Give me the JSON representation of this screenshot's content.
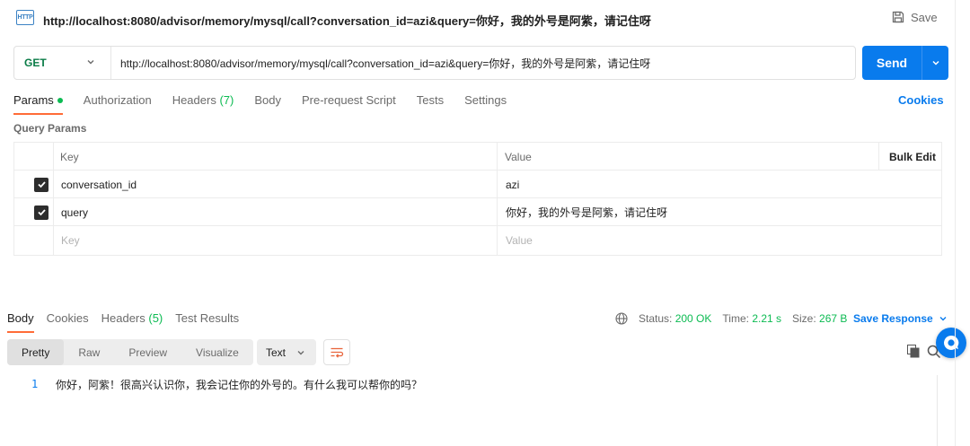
{
  "header": {
    "badge": "HTTP",
    "title": "http://localhost:8080/advisor/memory/mysql/call?conversation_id=azi&query=你好，我的外号是阿紫，请记住呀",
    "save_label": "Save"
  },
  "request": {
    "method": "GET",
    "url": "http://localhost:8080/advisor/memory/mysql/call?conversation_id=azi&query=你好，我的外号是阿紫，请记住呀",
    "send_label": "Send"
  },
  "tabs": {
    "params": "Params",
    "authorization": "Authorization",
    "headers": "Headers",
    "headers_count": "(7)",
    "body": "Body",
    "pre_request": "Pre-request Script",
    "tests": "Tests",
    "settings": "Settings",
    "cookies": "Cookies"
  },
  "query_params": {
    "label": "Query Params",
    "key_header": "Key",
    "value_header": "Value",
    "bulk_edit": "Bulk Edit",
    "rows": [
      {
        "key": "conversation_id",
        "value": "azi"
      },
      {
        "key": "query",
        "value": "你好，我的外号是阿紫，请记住呀"
      }
    ],
    "key_placeholder": "Key",
    "value_placeholder": "Value"
  },
  "response": {
    "tabs": {
      "body": "Body",
      "cookies": "Cookies",
      "headers": "Headers",
      "headers_count": "(5)",
      "test_results": "Test Results"
    },
    "status_label": "Status:",
    "status_value": "200 OK",
    "time_label": "Time:",
    "time_value": "2.21 s",
    "size_label": "Size:",
    "size_value": "267 B",
    "save_response": "Save Response",
    "views": [
      "Pretty",
      "Raw",
      "Preview",
      "Visualize"
    ],
    "format": "Text",
    "line_number": "1",
    "body_text": "你好，阿紫！很高兴认识你，我会记住你的外号的。有什么我可以帮你的吗？"
  },
  "colors": {
    "accent": "#097bed",
    "success": "#0cbb52",
    "active_tab": "#ff6c37"
  }
}
